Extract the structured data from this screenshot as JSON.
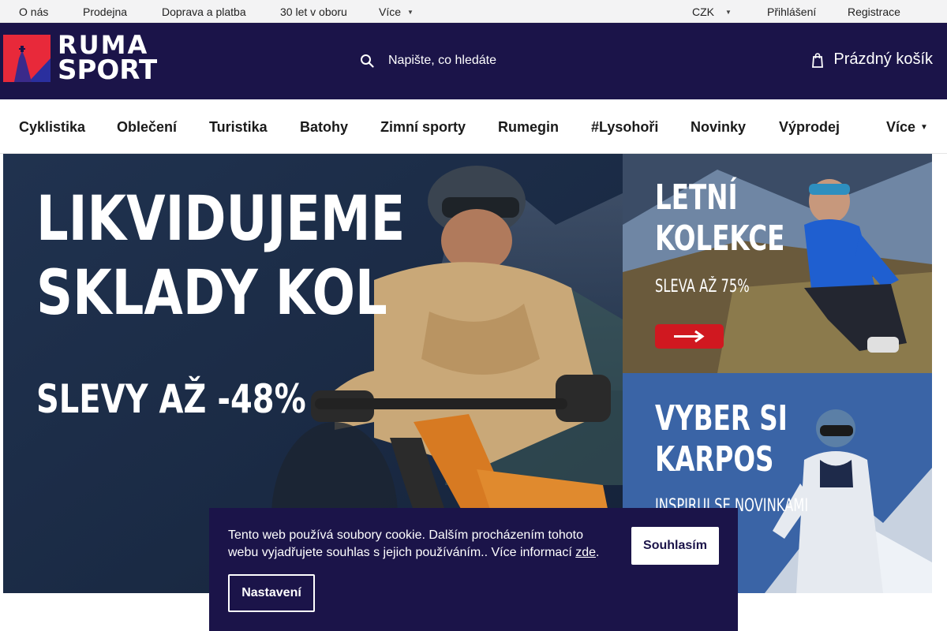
{
  "topbar": {
    "links": [
      "O nás",
      "Prodejna",
      "Doprava a platba",
      "30 let v oboru"
    ],
    "more": "Více",
    "currency": "CZK",
    "login": "Přihlášení",
    "register": "Registrace"
  },
  "header": {
    "logo_line1": "RUMA",
    "logo_line2": "SPORT",
    "search_placeholder": "Napište, co hledáte",
    "cart": "Prázdný košík"
  },
  "nav": {
    "items": [
      "Cyklistika",
      "Oblečení",
      "Turistika",
      "Batohy",
      "Zimní sporty",
      "Rumegin",
      "#Lysohoři",
      "Novinky",
      "Výprodej"
    ],
    "more": "Více"
  },
  "banners": {
    "main": {
      "line1": "LIKVIDUJEME",
      "line2": "SKLADY KOL",
      "line3": "SLEVY AŽ -48%"
    },
    "side1": {
      "line1": "LETNÍ",
      "line2": "KOLEKCE",
      "line3": "SLEVA AŽ 75%"
    },
    "side2": {
      "line1": "VYBER SI",
      "line2": "KARPOS",
      "line3": "INSPIRUJ SE NOVINKAMI"
    }
  },
  "cookie": {
    "message": "Tento web používá soubory cookie. Dalším procházením tohoto webu vyjadřujete souhlas s jejich používáním.. Více informací ",
    "link": "zde",
    "period": ".",
    "agree": "Souhlasím",
    "settings": "Nastavení"
  },
  "colors": {
    "brand_navy": "#1b1449",
    "logo_red": "#e8293a",
    "logo_blue": "#2a2f9e",
    "arrow_button_red": "#d01820"
  },
  "icons": [
    "chevron-down-icon",
    "search-icon",
    "cart-icon",
    "arrow-right-icon"
  ]
}
